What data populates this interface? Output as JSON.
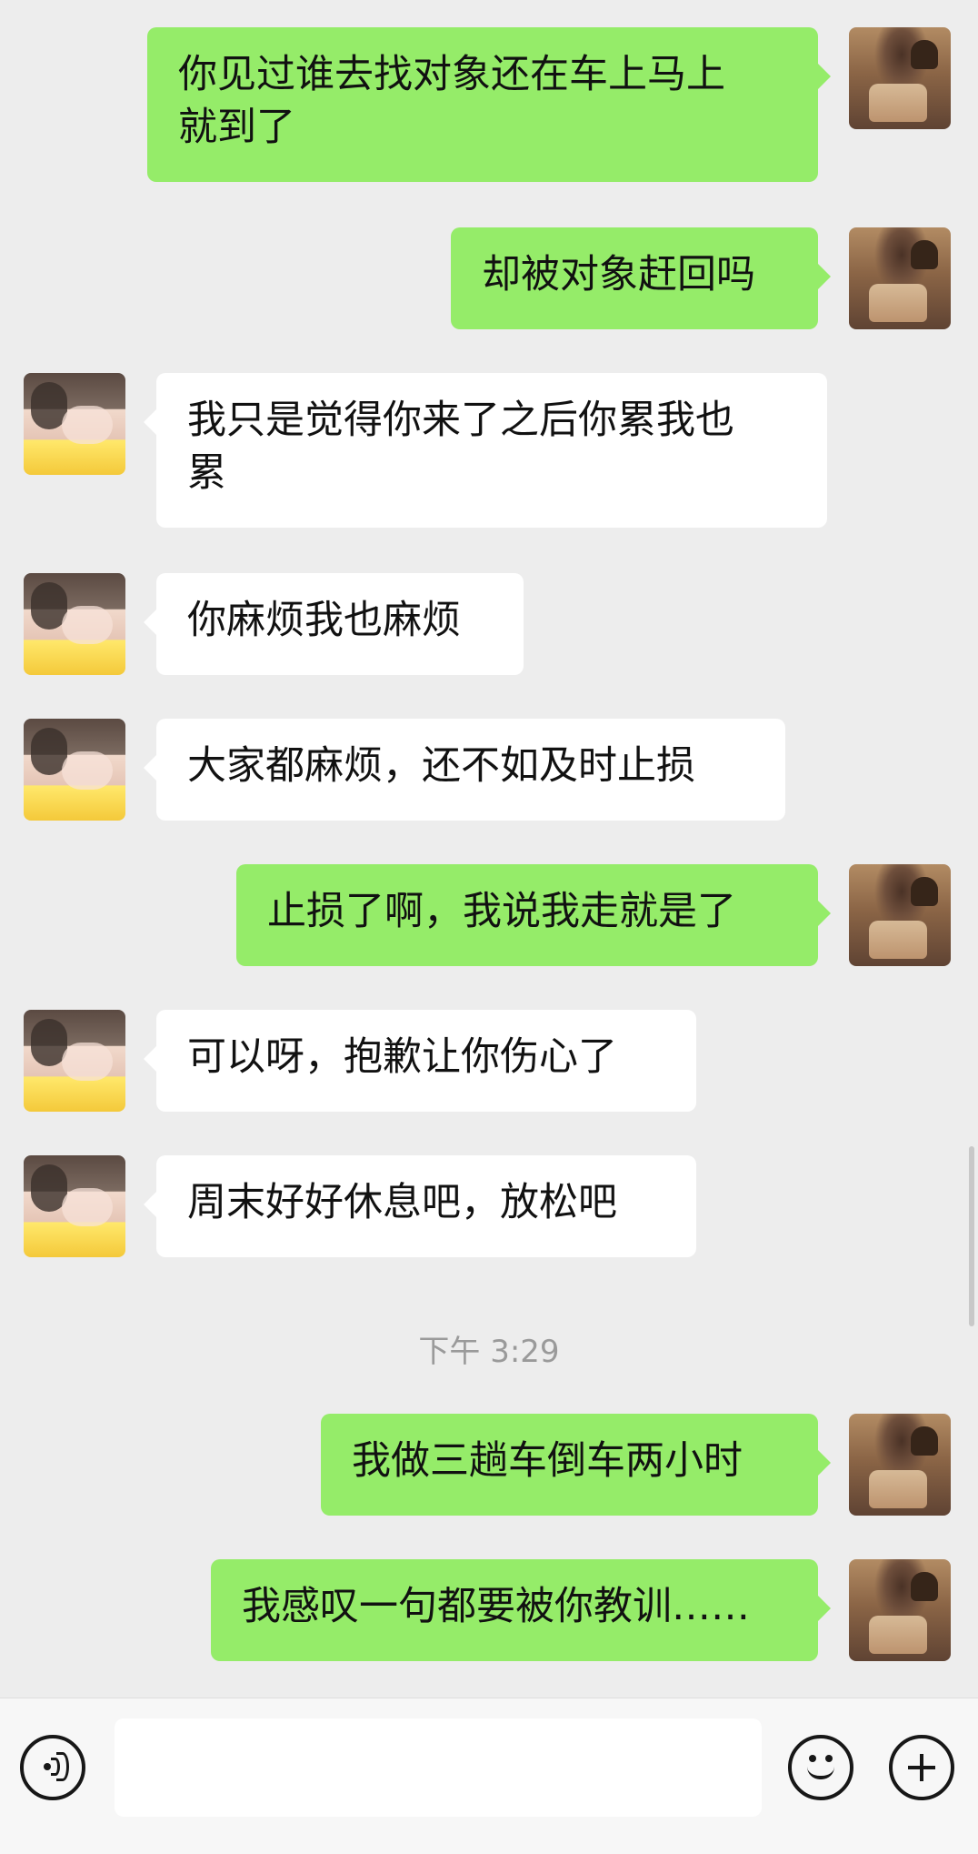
{
  "messages": [
    {
      "side": "right",
      "text": "你见过谁去找对象还在车上马上\n就到了"
    },
    {
      "side": "right",
      "text": "却被对象赶回吗"
    },
    {
      "side": "left",
      "text": "我只是觉得你来了之后你累我也\n累"
    },
    {
      "side": "left",
      "text": "你麻烦我也麻烦"
    },
    {
      "side": "left",
      "text": "大家都麻烦，还不如及时止损"
    },
    {
      "side": "right",
      "text": "止损了啊，我说我走就是了"
    },
    {
      "side": "left",
      "text": "可以呀，抱歉让你伤心了"
    },
    {
      "side": "left",
      "text": "周末好好休息吧，放松吧"
    },
    {
      "side": "right",
      "text": "我做三趟车倒车两小时"
    },
    {
      "side": "right",
      "text": "我感叹一句都要被你教训……"
    }
  ],
  "timestamp": "下午 3:29",
  "colors": {
    "chat_background": "#ededed",
    "self_bubble": "#95ec69",
    "other_bubble": "#ffffff",
    "timestamp_text": "#9a9a9a"
  },
  "toolbar": {
    "voice_icon": "voice-icon",
    "emoji_icon": "emoji-icon",
    "plus_icon": "plus-icon",
    "input_value": ""
  }
}
